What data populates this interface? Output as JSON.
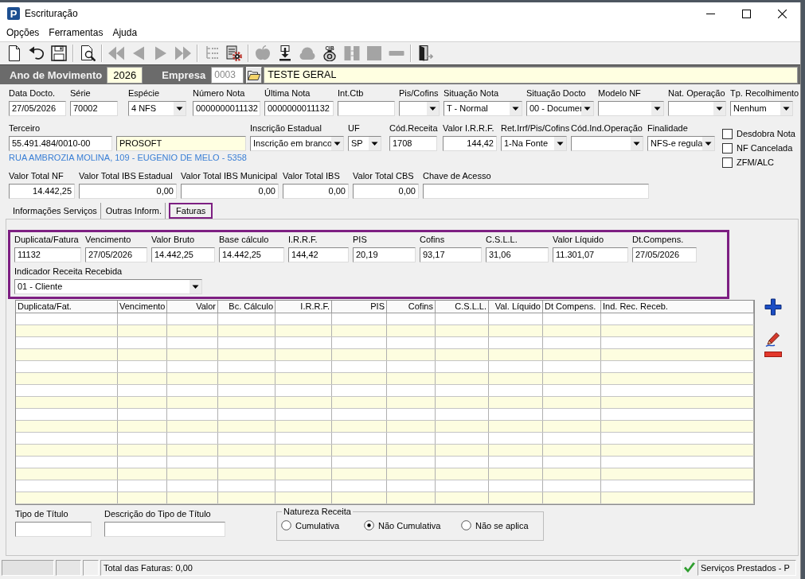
{
  "window": {
    "icon_letter": "P",
    "title": "Escrituração"
  },
  "menu": [
    "Opções",
    "Ferramentas",
    "Ajuda"
  ],
  "toolbar": [
    {
      "kind": "new",
      "disabled": false
    },
    {
      "kind": "undo",
      "disabled": false
    },
    {
      "kind": "save",
      "disabled": false
    },
    {
      "kind": "separator"
    },
    {
      "kind": "preview",
      "disabled": false
    },
    {
      "kind": "separator"
    },
    {
      "kind": "first",
      "disabled": true
    },
    {
      "kind": "previous",
      "disabled": true
    },
    {
      "kind": "next",
      "disabled": true
    },
    {
      "kind": "last",
      "disabled": true
    },
    {
      "kind": "separator"
    },
    {
      "kind": "tree",
      "disabled": true
    },
    {
      "kind": "gears",
      "disabled": false
    },
    {
      "kind": "separator"
    },
    {
      "kind": "fruit",
      "disabled": true
    },
    {
      "kind": "download",
      "disabled": false
    },
    {
      "kind": "cloud",
      "disabled": true
    },
    {
      "kind": "coin",
      "label": "CIB",
      "disabled": false
    },
    {
      "kind": "split",
      "disabled": true
    },
    {
      "kind": "square",
      "disabled": true
    },
    {
      "kind": "dash",
      "disabled": true
    },
    {
      "kind": "separator"
    },
    {
      "kind": "exit",
      "disabled": false
    }
  ],
  "header_bar": {
    "year_label": "Ano de Movimento",
    "year": "2026",
    "company_label": "Empresa",
    "company_code": "0003",
    "company_code_disabled": true,
    "company_name": "TESTE GERAL"
  },
  "document": {
    "row_1": [
      {
        "label": "Data Docto.",
        "kind": "text",
        "value": "27/05/2026"
      },
      {
        "label": "Série",
        "kind": "text",
        "value": "70002"
      },
      {
        "label": "Espécie",
        "kind": "dropdown",
        "value": "4 NFS"
      },
      {
        "label": "Número Nota",
        "kind": "text",
        "value": "0000000011132"
      },
      {
        "label": "Última Nota",
        "kind": "text",
        "value": "0000000011132"
      },
      {
        "label": "Int.Ctb",
        "kind": "text"
      },
      {
        "label": "Pis/Cofins",
        "kind": "dropdown"
      },
      {
        "label": "Situação Nota",
        "kind": "dropdown",
        "value": "T - Normal"
      },
      {
        "label": "Situação Docto",
        "kind": "dropdown",
        "value": "00 - Documer"
      },
      {
        "label": "Modelo NF",
        "kind": "dropdown"
      },
      {
        "label": "Nat. Operação",
        "kind": "dropdown"
      },
      {
        "label": "Tp. Recolhimento",
        "kind": "dropdown",
        "value": "Nenhum"
      }
    ],
    "row_2": [
      {
        "label": "Terceiro",
        "kind": "text",
        "value": "55.491.484/0010-00"
      },
      {
        "kind": "display",
        "value": "PROSOFT"
      },
      {
        "label": "Inscrição Estadual",
        "kind": "dropdown",
        "value": "Inscrição em branco"
      },
      {
        "label": "UF",
        "kind": "dropdown",
        "value": "SP"
      },
      {
        "label": "Cód.Receita",
        "kind": "text",
        "value": "1708"
      },
      {
        "label": "Valor I.R.R.F.",
        "kind": "number",
        "value": "144,42"
      },
      {
        "label": "Ret.Irrf/Pis/Cofins",
        "kind": "dropdown",
        "value": "1-Na Fonte"
      },
      {
        "label": "Cód.Ind.Operação",
        "kind": "dropdown"
      },
      {
        "label": "Finalidade",
        "kind": "dropdown",
        "value": "NFS-e regula"
      }
    ],
    "address": "RUA AMBROZIA MOLINA, 109 - EUGENIO DE MELO - 5358",
    "options": [
      {
        "label": "Desdobra Nota",
        "checked": false
      },
      {
        "label": "NF Cancelada",
        "checked": false
      },
      {
        "label": "ZFM/ALC",
        "checked": false
      }
    ],
    "row_3": [
      {
        "label": "Valor Total NF",
        "kind": "number",
        "value": "14.442,25"
      },
      {
        "label": "Valor Total IBS Estadual",
        "kind": "number",
        "value": "0,00"
      },
      {
        "label": "Valor Total IBS Municipal",
        "kind": "number",
        "value": "0,00"
      },
      {
        "label": "Valor Total IBS",
        "kind": "number",
        "value": "0,00"
      },
      {
        "label": "Valor Total CBS",
        "kind": "number",
        "value": "0,00"
      },
      {
        "label": "Chave de Acesso",
        "kind": "text"
      }
    ]
  },
  "tabs": [
    {
      "label": "Informações Serviços",
      "selected": false
    },
    {
      "label": "Outras Inform.",
      "selected": false
    },
    {
      "label": "Faturas",
      "selected": true
    }
  ],
  "invoice": {
    "row_1": [
      {
        "label": "Duplicata/Fatura",
        "kind": "text",
        "value": "11132"
      },
      {
        "label": "Vencimento",
        "kind": "text",
        "value": "27/05/2026"
      },
      {
        "label": "Valor Bruto",
        "kind": "text",
        "value": "14.442,25"
      },
      {
        "label": "Base cálculo",
        "kind": "text",
        "value": "14.442,25"
      },
      {
        "label": "I.R.R.F.",
        "kind": "text",
        "value": "144,42"
      },
      {
        "label": "PIS",
        "kind": "text",
        "value": "20,19"
      },
      {
        "label": "Cofins",
        "kind": "text",
        "value": "93,17"
      },
      {
        "label": "C.S.L.L.",
        "kind": "text",
        "value": "31,06"
      },
      {
        "label": "Valor Líquido",
        "kind": "text",
        "value": "11.301,07"
      },
      {
        "label": "Dt.Compens.",
        "kind": "text",
        "value": "27/05/2026"
      }
    ],
    "row_2": [
      {
        "label": "Indicador Receita Recebida",
        "kind": "dropdown",
        "value": "01 - Cliente"
      }
    ]
  },
  "invoice_table": {
    "columns": [
      {
        "label": "Duplicata/Fat.",
        "kind": "text"
      },
      {
        "label": "Vencimento",
        "kind": "text"
      },
      {
        "label": "Valor",
        "kind": "number"
      },
      {
        "label": "Bc. Cálculo",
        "kind": "number"
      },
      {
        "label": "I.R.R.F.",
        "kind": "number"
      },
      {
        "label": "PIS",
        "kind": "number"
      },
      {
        "label": "Cofins",
        "kind": "number"
      },
      {
        "label": "C.S.L.L.",
        "kind": "number"
      },
      {
        "label": "Val. Líquido",
        "kind": "number"
      },
      {
        "label": "Dt Compens.",
        "kind": "text"
      },
      {
        "label": "Ind. Rec. Receb.",
        "kind": "text"
      }
    ]
  },
  "title_fields": [
    {
      "label": "Tipo de Título",
      "kind": "text"
    },
    {
      "label": "Descrição do Tipo de Título",
      "kind": "text"
    }
  ],
  "revenue_nature": {
    "title": "Natureza Receita",
    "options": [
      {
        "label": "Cumulativa",
        "selected": false
      },
      {
        "label": "Não Cumulativa",
        "selected": true
      },
      {
        "label": "Não se aplica",
        "selected": false
      }
    ]
  },
  "status_bar": {
    "total": "Total das Faturas: 0,00",
    "mode": "Serviços Prestados - P"
  }
}
